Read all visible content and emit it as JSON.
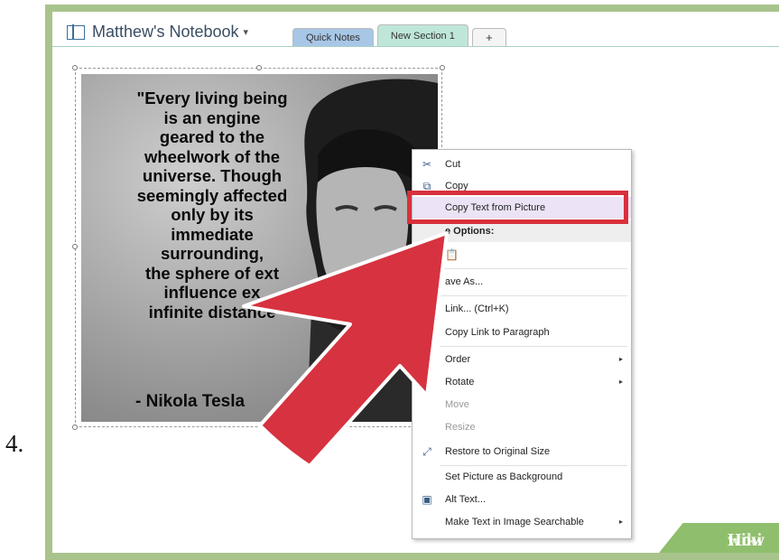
{
  "step": {
    "number": "4."
  },
  "notebook": {
    "title": "Matthew's Notebook",
    "caret": "▾"
  },
  "tabs": [
    {
      "label": "Quick Notes"
    },
    {
      "label": "New Section 1"
    },
    {
      "label": "+"
    }
  ],
  "picture": {
    "quote": "\"Every living being\nis an engine\ngeared to the\nwheelwork of the\nuniverse. Though\nseemingly affected\nonly by its\nimmediate\nsurrounding,\nthe sphere of ext\ninfluence ex\ninfinite distance",
    "attribution": "- Nikola Tesla"
  },
  "context_menu": {
    "items": [
      {
        "label": "Cut",
        "icon": "scissors-icon"
      },
      {
        "label": "Copy",
        "icon": "copy-icon"
      },
      {
        "label": "Copy Text from Picture",
        "highlighted": true
      },
      {
        "label": "e Options:",
        "section": true
      },
      {
        "label": "",
        "icon": "paste-icon"
      },
      {
        "label": "ave As..."
      },
      {
        "label": "Link...  (Ctrl+K)"
      },
      {
        "label": "Copy Link to Paragraph"
      },
      {
        "label": "Order",
        "submenu": true
      },
      {
        "label": "Rotate",
        "submenu": true
      },
      {
        "label": "Move",
        "disabled": true
      },
      {
        "label": "Resize",
        "disabled": true
      },
      {
        "label": "Restore to Original Size",
        "icon": "restore-size-icon"
      },
      {
        "label": "Set Picture as Background"
      },
      {
        "label": "Alt Text...",
        "icon": "alt-text-icon"
      },
      {
        "label": "Make Text in Image Searchable",
        "submenu": true
      }
    ],
    "submenu_arrow": "▸"
  },
  "colors": {
    "callout": "#d8303c",
    "arrow": "#d7323f",
    "frame": "#a9c38c",
    "tab_new": "#bfe7d9",
    "tab_quick": "#a8c6e6"
  },
  "watermark": {
    "part1": "wiki",
    "part2": "How"
  }
}
